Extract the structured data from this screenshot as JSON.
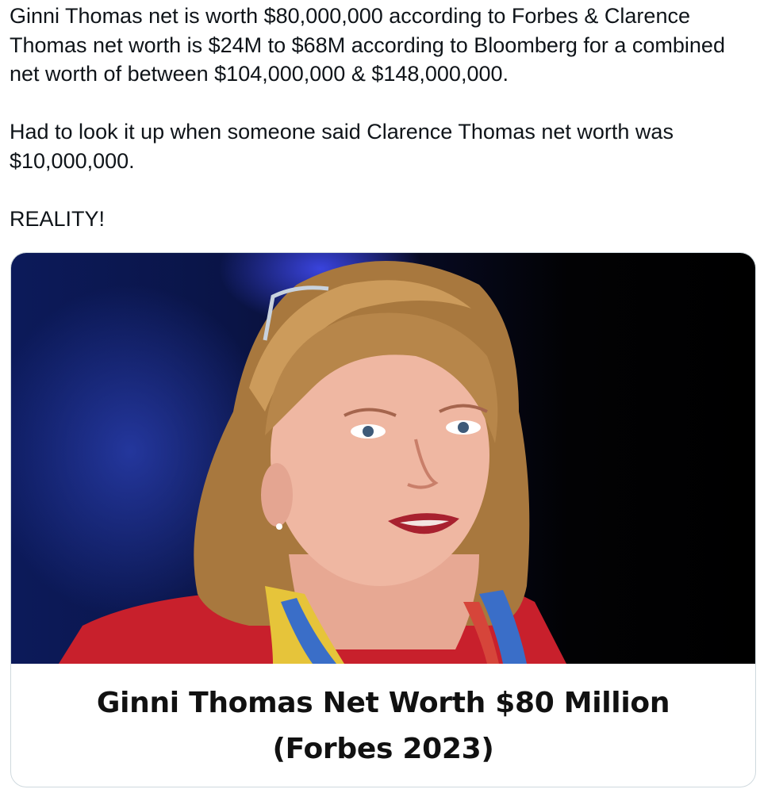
{
  "tweet": {
    "paragraphs": [
      "Ginni Thomas net is worth $80,000,000 according to Forbes & Clarence Thomas net worth is $24M to $68M according to Bloomberg for a combined net worth of between $104,000,000 & $148,000,000.",
      "Had to look it up when someone said Clarence Thomas net worth was $10,000,000.",
      "REALITY!"
    ]
  },
  "card": {
    "title": "Ginni Thomas Net Worth $80 Million (Forbes 2023)"
  }
}
